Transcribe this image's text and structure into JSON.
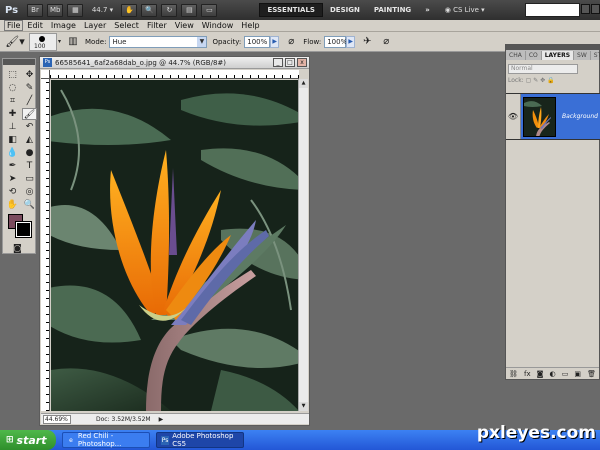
{
  "appbar": {
    "logo": "Ps",
    "bridge_btn": "Br",
    "minibridge_btn": "Mb",
    "zoom": "44.7",
    "workspaces": [
      "ESSENTIALS",
      "DESIGN",
      "PAINTING"
    ],
    "more": "»",
    "cs_live": "CS Live"
  },
  "menu": [
    "File",
    "Edit",
    "Image",
    "Layer",
    "Select",
    "Filter",
    "View",
    "Window",
    "Help"
  ],
  "options": {
    "brush_size": "100",
    "mode_label": "Mode:",
    "mode_value": "Hue",
    "opacity_label": "Opacity:",
    "opacity_value": "100%",
    "flow_label": "Flow:",
    "flow_value": "100%"
  },
  "colors": {
    "foreground": "#7a4b5e",
    "background": "#000000"
  },
  "document": {
    "title": "66585641_6af2a68dab_o.jpg @ 44.7% (RGB/8#)",
    "zoom_status": "44.69%",
    "doc_info": "Doc: 3.52M/3.52M"
  },
  "layers_panel": {
    "tabs": [
      "CHA",
      "CO",
      "LAYERS",
      "SW",
      "STY"
    ],
    "blend_mode": "Normal",
    "lock_label": "Lock:",
    "layer_name": "Background"
  },
  "taskbar": {
    "start": "start",
    "items": [
      "Red Chili - Photoshop...",
      "Adobe Photoshop CS5"
    ]
  },
  "watermark": "pxleyes.com"
}
